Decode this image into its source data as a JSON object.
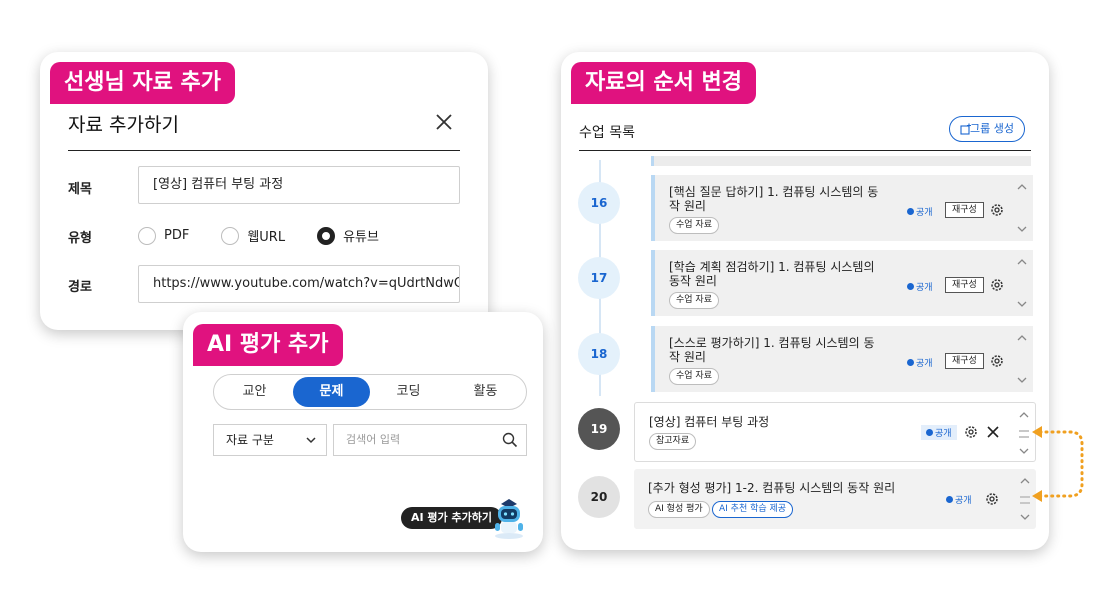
{
  "add_material": {
    "badge": "선생님 자료 추가",
    "title": "자료 추가하기",
    "fields": {
      "title_label": "제목",
      "title_value": "[영상] 컴퓨터 부팅 과정",
      "type_label": "유형",
      "type_options": [
        "PDF",
        "웹URL",
        "유튜브"
      ],
      "type_selected": "유튜브",
      "path_label": "경로",
      "path_value": "https://www.youtube.com/watch?v=qUdrtNdwQ"
    }
  },
  "ai_eval": {
    "badge": "AI 평가 추가",
    "tabs": [
      "교안",
      "문제",
      "코딩",
      "활동"
    ],
    "active_tab": "문제",
    "filter_label": "자료 구분",
    "search_placeholder": "검색어 입력",
    "ai_button": "AI 평가 추가하기"
  },
  "reorder": {
    "badge": "자료의 순서 변경",
    "list_title": "수업 목록",
    "group_button": "그룹 생성",
    "public_label": "공개",
    "restructure_label": "재구성",
    "rows": [
      {
        "num": "16",
        "title": "[핵심 질문 답하기] 1. 컴퓨팅 시스템의 동작 원리",
        "tags": [
          "수업 자료"
        ]
      },
      {
        "num": "17",
        "title": "[학습 계획 점검하기] 1. 컴퓨팅 시스템의 동작 원리",
        "tags": [
          "수업 자료"
        ]
      },
      {
        "num": "18",
        "title": "[스스로 평가하기] 1. 컴퓨팅 시스템의 동작 원리",
        "tags": [
          "수업 자료"
        ]
      },
      {
        "num": "19",
        "title": "[영상] 컴퓨터 부팅 과정",
        "tags": [
          "참고자료"
        ]
      },
      {
        "num": "20",
        "title": "[추가 형성 평가] 1-2. 컴퓨팅 시스템의 동작 원리",
        "tags": [
          "AI 형성 평가",
          "AI 추천 학습 제공"
        ]
      }
    ],
    "colors": {
      "accent": "#1a66d0",
      "badge": "#e0127f",
      "drag_arrow": "#f0a020"
    }
  }
}
